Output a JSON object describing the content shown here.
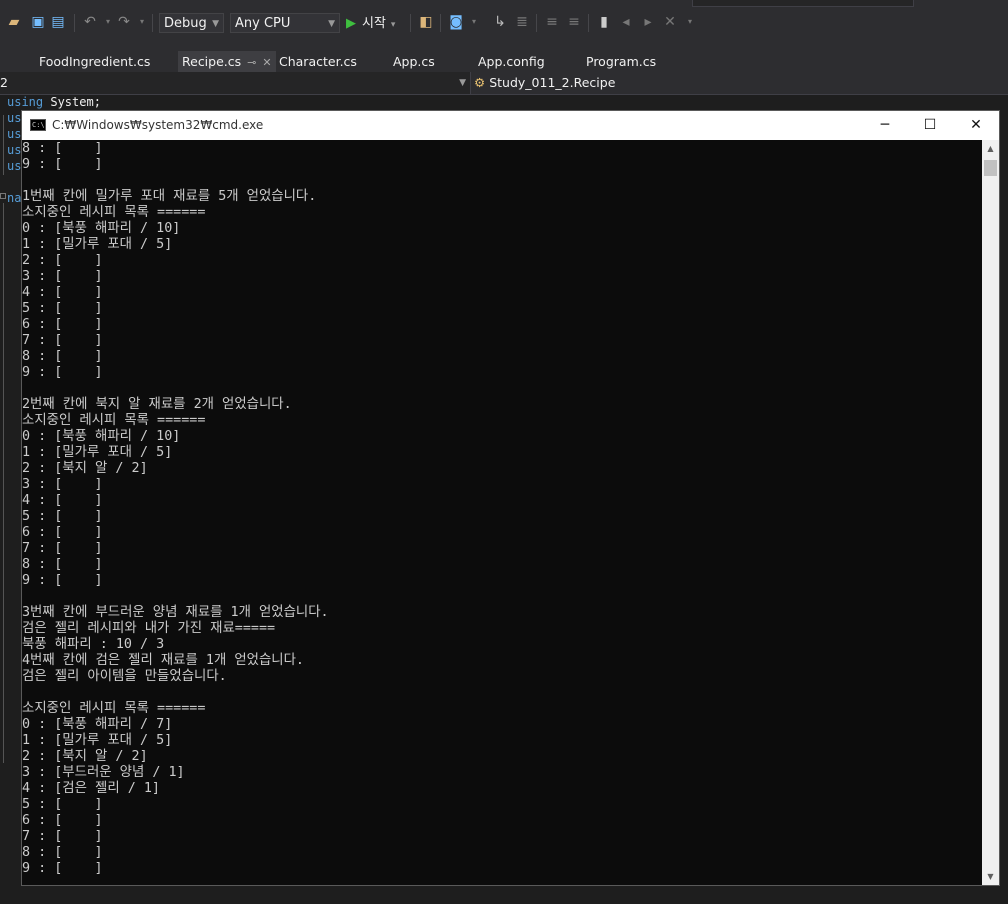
{
  "toolbar": {
    "config_label": "Debug",
    "platform_label": "Any CPU",
    "start_label": "시작"
  },
  "tabs": [
    {
      "label": "FoodIngredient.cs"
    },
    {
      "label": "Recipe.cs"
    },
    {
      "label": "Character.cs"
    },
    {
      "label": "App.cs"
    },
    {
      "label": "App.config"
    },
    {
      "label": "Program.cs"
    }
  ],
  "navbar": {
    "left_label": "2",
    "right_label": "Study_011_2.Recipe"
  },
  "editor": {
    "using_keyword": "using",
    "using_rest": " System;",
    "partial_lines": [
      "us",
      "us",
      "us",
      "us"
    ],
    "namespace_partial": "na"
  },
  "cmd": {
    "title": "C:₩Windows₩system32₩cmd.exe",
    "lines": [
      "8 : [    ]",
      "9 : [    ]",
      "",
      "1번째 칸에 밀가루 포대 재료를 5개 얻었습니다.",
      "소지중인 레시피 목록 ======",
      "0 : [북풍 해파리 / 10]",
      "1 : [밀가루 포대 / 5]",
      "2 : [    ]",
      "3 : [    ]",
      "4 : [    ]",
      "5 : [    ]",
      "6 : [    ]",
      "7 : [    ]",
      "8 : [    ]",
      "9 : [    ]",
      "",
      "2번째 칸에 북지 알 재료를 2개 얻었습니다.",
      "소지중인 레시피 목록 ======",
      "0 : [북풍 해파리 / 10]",
      "1 : [밀가루 포대 / 5]",
      "2 : [북지 알 / 2]",
      "3 : [    ]",
      "4 : [    ]",
      "5 : [    ]",
      "6 : [    ]",
      "7 : [    ]",
      "8 : [    ]",
      "9 : [    ]",
      "",
      "3번째 칸에 부드러운 양념 재료를 1개 얻었습니다.",
      "검은 젤리 레시피와 내가 가진 재료=====",
      "북풍 해파리 : 10 / 3",
      "4번째 칸에 검은 젤리 재료를 1개 얻었습니다.",
      "검은 젤리 아이템을 만들었습니다.",
      "",
      "소지중인 레시피 목록 ======",
      "0 : [북풍 해파리 / 7]",
      "1 : [밀가루 포대 / 5]",
      "2 : [북지 알 / 2]",
      "3 : [부드러운 양념 / 1]",
      "4 : [검은 젤리 / 1]",
      "5 : [    ]",
      "6 : [    ]",
      "7 : [    ]",
      "8 : [    ]",
      "9 : [    ]"
    ]
  }
}
